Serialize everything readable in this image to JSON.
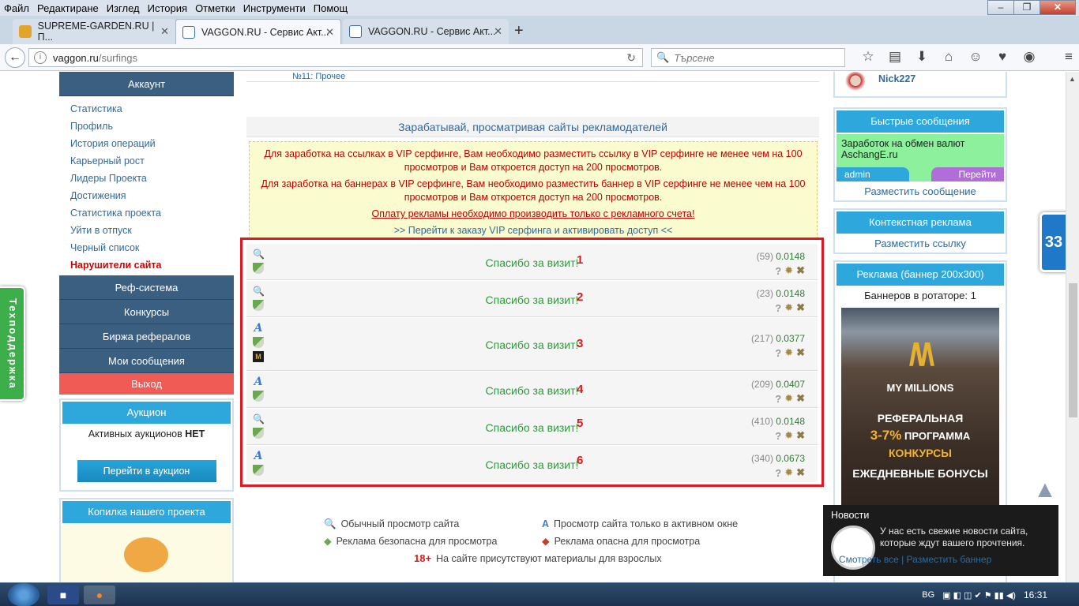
{
  "browser": {
    "menu": [
      "Файл",
      "Редактиране",
      "Изглед",
      "История",
      "Отметки",
      "Инструменти",
      "Помощ"
    ],
    "tabs": [
      {
        "label": "SUPREME-GARDEN.RU | П...",
        "active": false
      },
      {
        "label": "VAGGON.RU - Сервис Акт...",
        "active": true
      },
      {
        "label": "VAGGON.RU - Сервис Акт...",
        "active": false
      }
    ],
    "url_host": "vaggon.ru",
    "url_path": "/surfings",
    "search_placeholder": "Търсене"
  },
  "sidebar": {
    "account_header": "Аккаунт",
    "links": [
      {
        "label": "Статистика"
      },
      {
        "label": "Профиль"
      },
      {
        "label": "История операций"
      },
      {
        "label": "Карьерный рост"
      },
      {
        "label": "Лидеры Проекта"
      },
      {
        "label": "Достижения"
      },
      {
        "label": "Статистика проекта"
      },
      {
        "label": "Уйти в отпуск"
      },
      {
        "label": "Черный список"
      },
      {
        "label": "Нарушители сайта"
      }
    ],
    "sections": [
      "Реф-система",
      "Конкурсы",
      "Биржа рефералов",
      "Мои сообщения"
    ],
    "logout": "Выход",
    "auction": {
      "title": "Аукцион",
      "text": "Активных аукционов",
      "status": "НЕТ",
      "button": "Перейти в аукцион"
    },
    "piggy_title": "Копилка нашего проекта"
  },
  "tech_support": "Техподдержка",
  "main": {
    "top_row_label": "№11: Прочее",
    "section_title": "Зарабатывай, просматривая сайты рекламодателей",
    "notice": {
      "p1": "Для заработка на ссылках в VIP серфинге, Вам необходимо разместить ссылку в VIP серфинге не менее чем на 100 просмотров и Вам откроется доступ на 200 просмотров.",
      "p2": "Для заработка на баннерах в VIP серфинге, Вам необходимо разместить баннер в VIP серфинге не менее чем на 100 просмотров и Вам откроется доступ на 200 просмотров.",
      "pay": "Оплату рекламы необходимо производить только с рекламного счета!",
      "order": ">> Перейти к заказу VIP серфинга и активировать доступ <<"
    },
    "rows": [
      {
        "thanks": "Спасибо за визит!",
        "num": "1",
        "count": "(59)",
        "price": "0.0148",
        "icons": [
          "search-icon",
          "shield-safe-icon"
        ]
      },
      {
        "thanks": "Спасибо за визит!",
        "num": "2",
        "count": "(23)",
        "price": "0.0148",
        "icons": [
          "search-icon",
          "shield-safe-icon"
        ]
      },
      {
        "thanks": "Спасибо за визит!",
        "num": "3",
        "count": "(217)",
        "price": "0.0377",
        "icons": [
          "active-window-icon",
          "shield-safe-icon",
          "site-logo-icon"
        ]
      },
      {
        "thanks": "Спасибо за визит!",
        "num": "4",
        "count": "(209)",
        "price": "0.0407",
        "icons": [
          "active-window-icon",
          "shield-safe-icon"
        ]
      },
      {
        "thanks": "Спасибо за визит!",
        "num": "5",
        "count": "(410)",
        "price": "0.0148",
        "icons": [
          "search-icon",
          "shield-safe-icon"
        ]
      },
      {
        "thanks": "Спасибо за визит!",
        "num": "6",
        "count": "(340)",
        "price": "0.0673",
        "icons": [
          "active-window-icon",
          "shield-safe-icon"
        ]
      }
    ],
    "legend": {
      "normal": "Обычный просмотр сайта",
      "active": "Просмотр сайта только в активном окне",
      "safe": "Реклама безопасна для просмотра",
      "danger": "Реклама опасна для просмотра",
      "adult_badge": "18+",
      "adult": "На сайте присутствуют материалы для взрослых"
    }
  },
  "right": {
    "user_nick": "Nick227",
    "fast_msg_title": "Быстрые сообщения",
    "fast_msg_text": "Заработок на обмен валют AschangE.ru",
    "fast_msg_author": "admin",
    "fast_msg_go": "Перейти",
    "post_msg": "Разместить сообщение",
    "context_title": "Контекстная реклама",
    "post_link": "Разместить ссылку",
    "banner_title": "Реклама (баннер 200x300)",
    "banner_rotator": "Баннеров в ротаторе: 1",
    "banner": {
      "brand": "MY MILLIONS",
      "line1": "РЕФЕРАЛЬНАЯ",
      "line2a": "3-7%",
      "line2b": "ПРОГРАММА",
      "line3": "КОНКУРСЫ",
      "line4": "ЕЖЕДНЕВНЫЕ БОНУСЫ"
    }
  },
  "counter": "33",
  "news": {
    "title": "Новости",
    "text": "У нас есть свежие новости сайта, которые ждут вашего прочтения.",
    "links": "Смотреть все | Разместить баннер"
  },
  "taskbar": {
    "lang": "BG",
    "time": "16:31"
  }
}
